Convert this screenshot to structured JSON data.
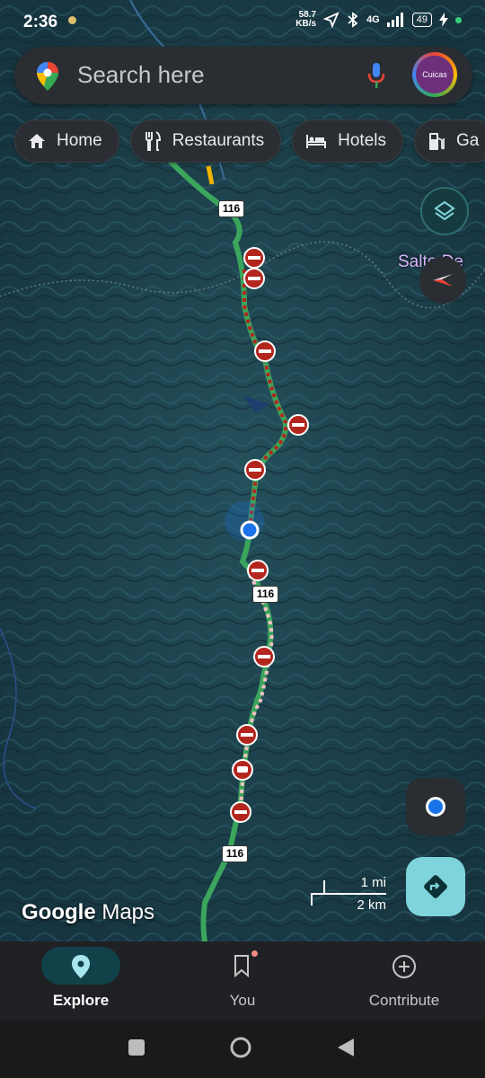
{
  "status_bar": {
    "time": "2:36",
    "net_speed_value": "58.7",
    "net_speed_unit": "KB/s",
    "network": "4G",
    "battery": "49"
  },
  "search": {
    "placeholder": "Search here",
    "avatar_text": "Cuicas"
  },
  "chips": [
    {
      "label": "Home",
      "icon": "home-icon"
    },
    {
      "label": "Restaurants",
      "icon": "restaurant-icon"
    },
    {
      "label": "Hotels",
      "icon": "hotel-icon"
    },
    {
      "label": "Ga",
      "icon": "gas-station-icon"
    }
  ],
  "map": {
    "route_labels": [
      "116",
      "116",
      "116"
    ],
    "poi_label": "Salto De",
    "brand": {
      "bold": "Google",
      "rest": " Maps"
    },
    "scale": {
      "imperial": "1 mi",
      "metric": "2 km"
    },
    "colors": {
      "terrain": "#1b3d47",
      "route": "#3ba55c",
      "closure": "#b3261e",
      "location": "#1a73e8",
      "accent": "#7fd4dc"
    }
  },
  "bottom_nav": [
    {
      "label": "Explore",
      "icon": "location-pin-icon",
      "active": true
    },
    {
      "label": "You",
      "icon": "bookmark-icon",
      "active": false
    },
    {
      "label": "Contribute",
      "icon": "add-circle-icon",
      "active": false
    }
  ]
}
